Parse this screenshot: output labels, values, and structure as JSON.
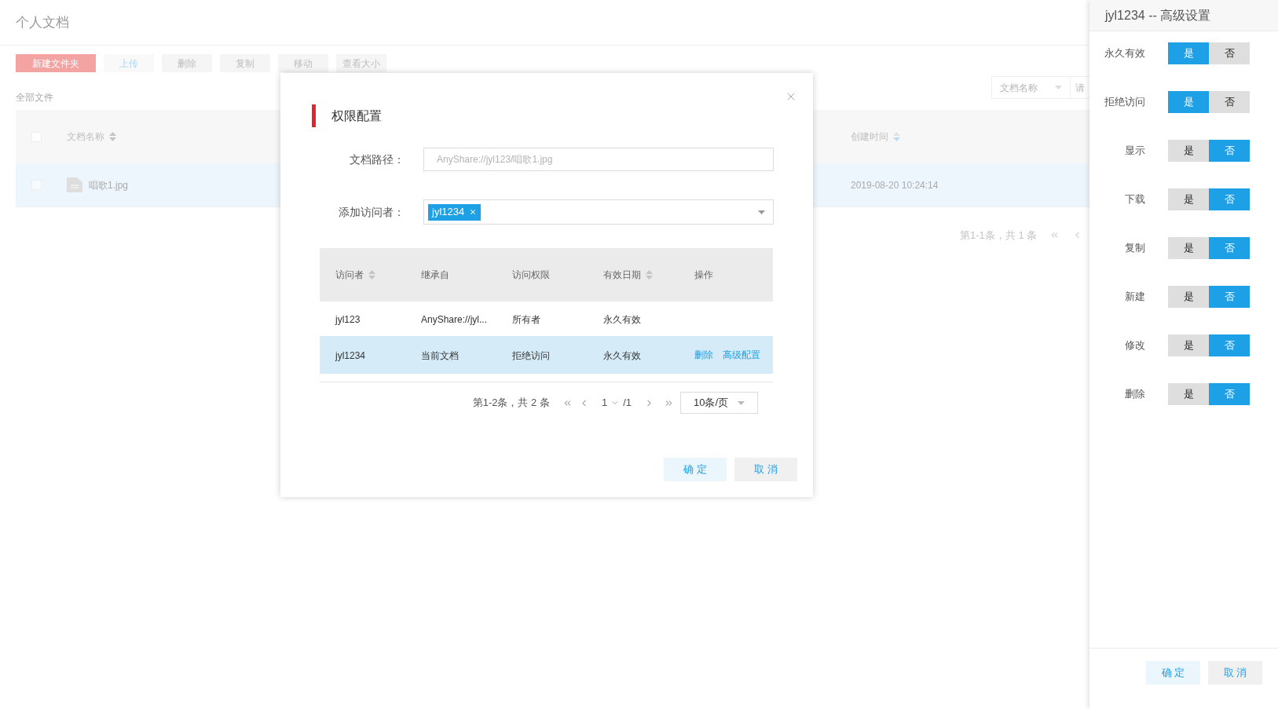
{
  "page": {
    "title": "个人文档",
    "toolbar": [
      {
        "label": "新建文件夹",
        "kind": "primary"
      },
      {
        "label": "上传",
        "kind": "enabled"
      },
      {
        "label": "删除",
        "kind": "disabled"
      },
      {
        "label": "复制",
        "kind": "disabled"
      },
      {
        "label": "移动",
        "kind": "disabled"
      },
      {
        "label": "查看大小",
        "kind": "disabled"
      }
    ],
    "breadcrumb": "全部文件",
    "search": {
      "field": "文档名称",
      "placeholder": "请"
    },
    "table": {
      "columns": [
        "文档名称",
        "创建时间"
      ],
      "all_checked": false,
      "rows": [
        {
          "name": "唱歌1.jpg",
          "created": "2019-08-20 10:24:14",
          "selected": true,
          "checked": false
        }
      ]
    },
    "pagination": {
      "summary": "第1-1条，共 1 条"
    }
  },
  "dialog": {
    "title": "权限配置",
    "path_label": "文档路径：",
    "path_value": "AnyShare://jyl123/唱歌1.jpg",
    "visitor_label": "添加访问者：",
    "visitor_tags": [
      "jyl1234"
    ],
    "table": {
      "columns": [
        {
          "label": "访问者",
          "sortable": true
        },
        {
          "label": "继承自",
          "sortable": false
        },
        {
          "label": "访问权限",
          "sortable": false
        },
        {
          "label": "有效日期",
          "sortable": true
        },
        {
          "label": "操作",
          "sortable": false
        }
      ],
      "rows": [
        {
          "visitor": "jyl123",
          "inherited": "AnyShare://jyl...",
          "permission": "所有者",
          "validity": "永久有效",
          "actions": [],
          "selected": false
        },
        {
          "visitor": "jyl1234",
          "inherited": "当前文档",
          "permission": "拒绝访问",
          "validity": "永久有效",
          "actions": [
            "删除",
            "高级配置"
          ],
          "selected": true
        }
      ]
    },
    "pagination": {
      "summary": "第1-2条，共 2 条",
      "page": "1",
      "total": "/1",
      "page_size": "10条/页"
    },
    "buttons": [
      "确 定",
      "取 消"
    ]
  },
  "advanced": {
    "title": "jyl1234 -- 高级设置",
    "settings": [
      {
        "label": "永久有效",
        "options": [
          {
            "label": "是",
            "selected": true
          },
          {
            "label": "否",
            "selected": false
          }
        ]
      },
      {
        "label": "拒绝访问",
        "options": [
          {
            "label": "是",
            "selected": true
          },
          {
            "label": "否",
            "selected": false
          }
        ]
      },
      {
        "label": "显示",
        "options": [
          {
            "label": "是",
            "selected": false
          },
          {
            "label": "否",
            "selected": true
          }
        ]
      },
      {
        "label": "下载",
        "options": [
          {
            "label": "是",
            "selected": false
          },
          {
            "label": "否",
            "selected": true
          }
        ]
      },
      {
        "label": "复制",
        "options": [
          {
            "label": "是",
            "selected": false
          },
          {
            "label": "否",
            "selected": true
          }
        ]
      },
      {
        "label": "新建",
        "options": [
          {
            "label": "是",
            "selected": false
          },
          {
            "label": "否",
            "selected": true
          }
        ]
      },
      {
        "label": "修改",
        "options": [
          {
            "label": "是",
            "selected": false
          },
          {
            "label": "否",
            "selected": true
          }
        ]
      },
      {
        "label": "删除",
        "options": [
          {
            "label": "是",
            "selected": false
          },
          {
            "label": "否",
            "selected": true
          }
        ]
      }
    ],
    "buttons": [
      "确 定",
      "取 消"
    ]
  }
}
